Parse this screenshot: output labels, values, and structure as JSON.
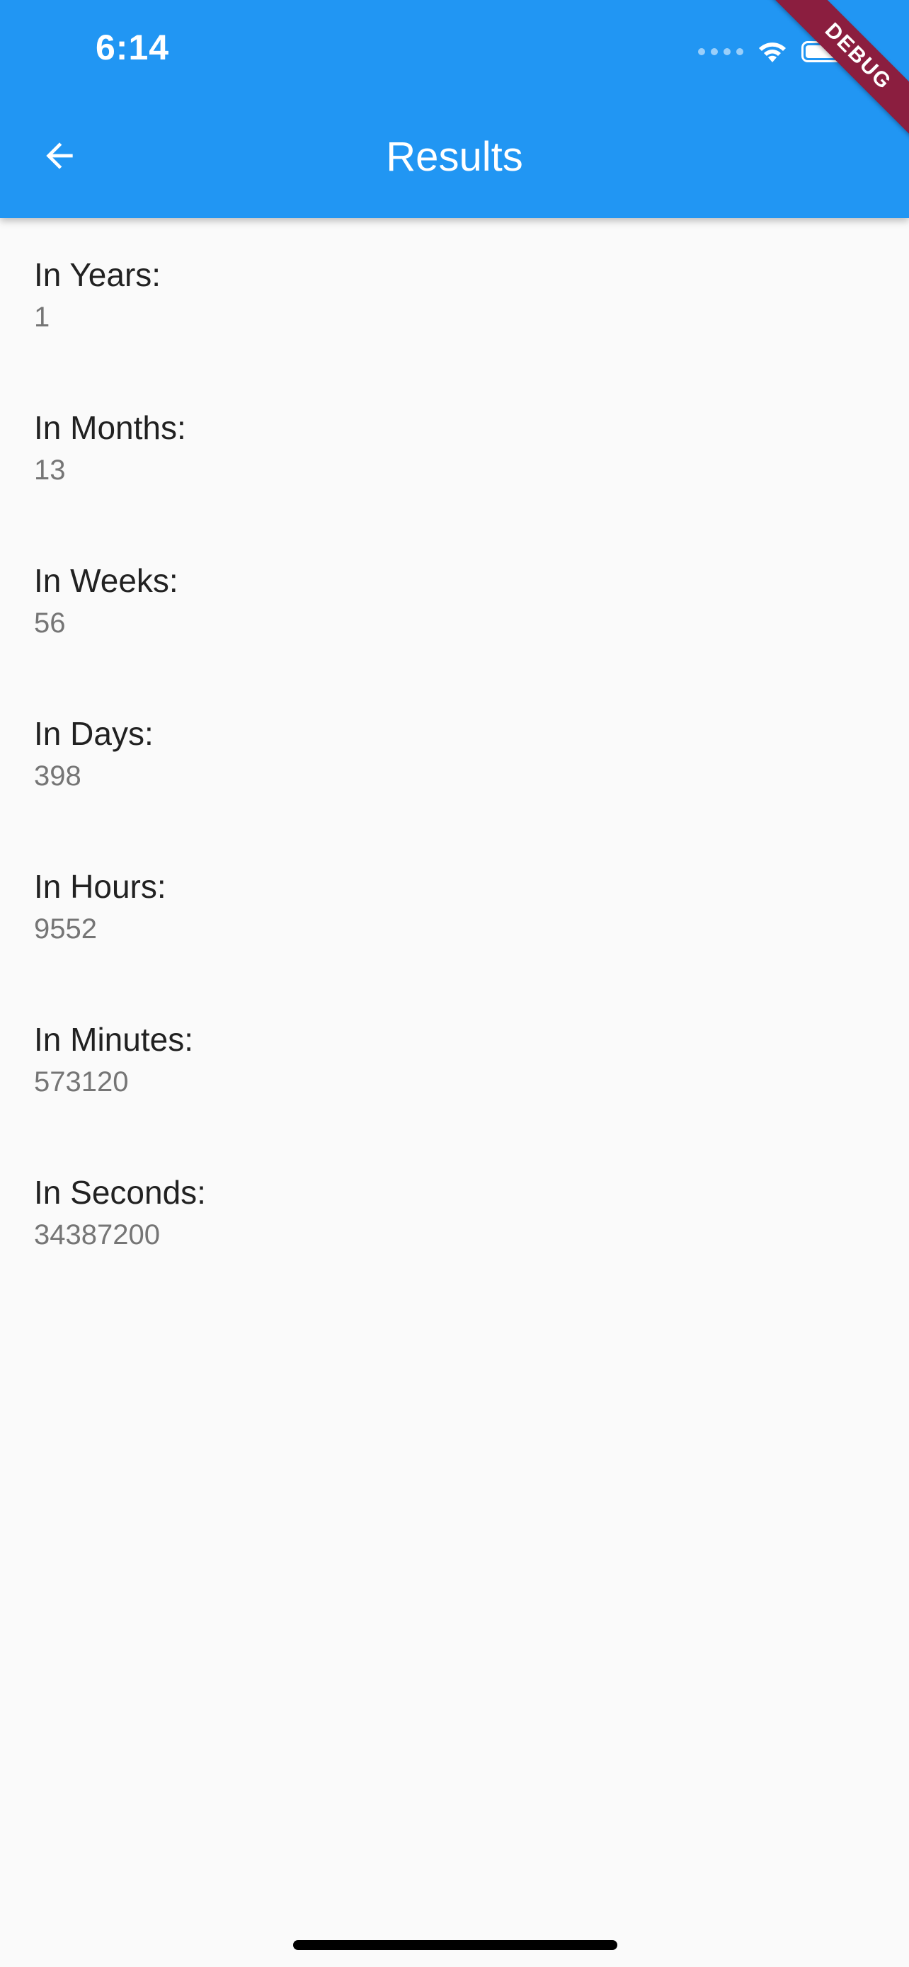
{
  "status_bar": {
    "time": "6:14",
    "icons": [
      "cellular-signal-icon",
      "wifi-icon",
      "battery-icon"
    ]
  },
  "app_bar": {
    "title": "Results",
    "back_icon": "arrow-back-icon",
    "background_color": "#2196f3"
  },
  "debug_banner": {
    "label": "DEBUG",
    "color": "#8b1e3f"
  },
  "results": [
    {
      "label": "In Years:",
      "value": "1"
    },
    {
      "label": "In Months:",
      "value": "13"
    },
    {
      "label": "In Weeks:",
      "value": "56"
    },
    {
      "label": "In Days:",
      "value": "398"
    },
    {
      "label": "In Hours:",
      "value": "9552"
    },
    {
      "label": "In Minutes:",
      "value": "573120"
    },
    {
      "label": "In Seconds:",
      "value": "34387200"
    }
  ]
}
